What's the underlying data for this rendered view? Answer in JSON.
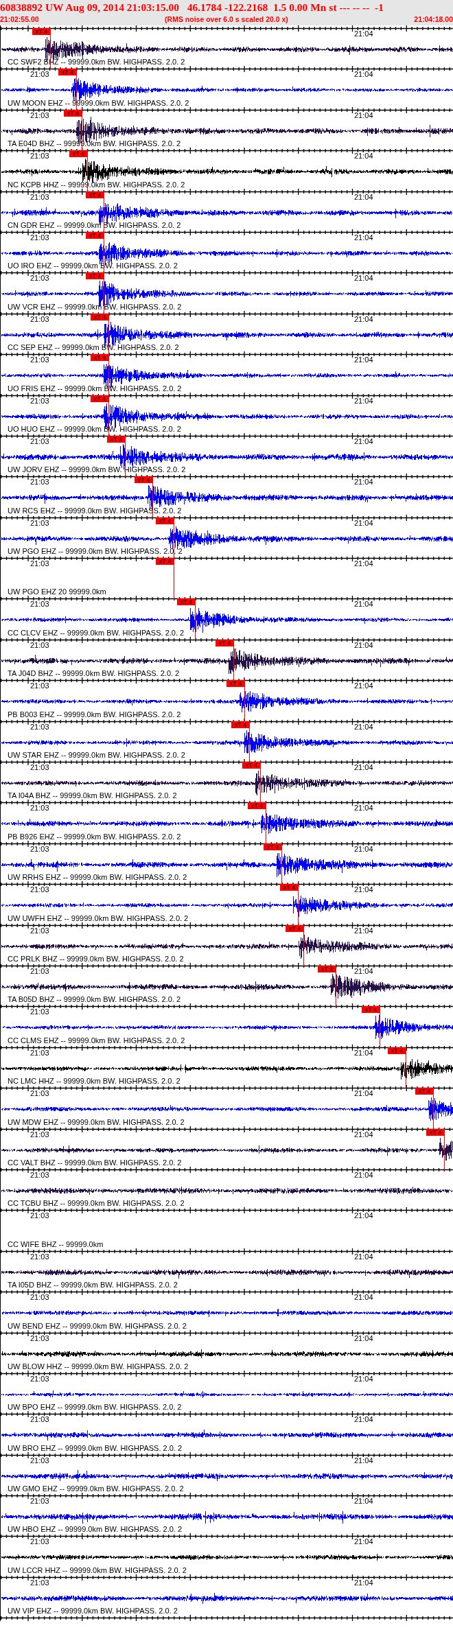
{
  "header": {
    "title": "60838892 UW Aug 09, 2014 21:03:15.00   46.1784 -122.2168  1.5 0.00 Mn st --- -- --  -1",
    "start_time": "21:02:55.00",
    "note": "(RMS noise over 6.0 s scaled 20.0 x)",
    "end_time": "21:04:18.00"
  },
  "traces": [
    {
      "label": "CC SWF2 BHZ -- 99999.0km BW. HIGHPASS. 2.0. 2",
      "kind": "broadband",
      "time_marks": {
        "right": "21:04"
      },
      "pick": {
        "text": "xT 4"
      }
    },
    {
      "label": "UW MOON EHZ -- 99999.0km BW. HIGHPASS. 2.0. 2",
      "kind": "shortperiod",
      "time_marks": {
        "left": "21:03",
        "right": "21:04"
      },
      "pick": {
        "text": "xT 4"
      }
    },
    {
      "label": "TA E04D BHZ -- 99999.0km BW. HIGHPASS. 2.0. 2",
      "kind": "broadband",
      "time_marks": {
        "left": "21:03",
        "right": "21:04"
      },
      "pick": {
        "text": "xT 4"
      }
    },
    {
      "label": "NC KCPB HHZ -- 99999.0km BW. HIGHPASS. 2.0. 2",
      "kind": "highrate",
      "time_marks": {
        "left": "21:03",
        "right": "21:04"
      },
      "pick": {
        "text": "xT 4"
      }
    },
    {
      "label": "CN GDR EHZ -- 99999.0km BW. HIGHPASS. 2.0. 2",
      "kind": "shortperiod",
      "time_marks": {
        "left": "21:03",
        "right": "21:04"
      },
      "pick": {
        "text": "xT 4"
      }
    },
    {
      "label": "UO IRO EHZ -- 99999.0km BW. HIGHPASS. 2.0. 2",
      "kind": "shortperiod",
      "time_marks": {
        "left": "21:03",
        "right": "21:04"
      },
      "pick": {
        "text": "xT 4"
      }
    },
    {
      "label": "UW VCR EHZ -- 99999.0km BW. HIGHPASS. 2.0. 2",
      "kind": "shortperiod",
      "time_marks": {
        "left": "21:03",
        "right": "21:04"
      },
      "pick": {
        "text": "xT 4"
      }
    },
    {
      "label": "CC SEP EHZ -- 99999.0km BW. HIGHPASS. 2.0. 2",
      "kind": "shortperiod",
      "time_marks": {
        "left": "21:03",
        "right": "21:04"
      },
      "pick": {
        "text": "xT 4"
      }
    },
    {
      "label": "UO FRIS EHZ -- 99999.0km BW. HIGHPASS. 2.0. 2",
      "kind": "shortperiod",
      "time_marks": {
        "left": "21:03",
        "right": "21:04"
      },
      "pick": {
        "text": "xT 4"
      }
    },
    {
      "label": "UO HUO EHZ -- 99999.0km BW. HIGHPASS. 2.0. 2",
      "kind": "shortperiod",
      "time_marks": {
        "left": "21:03",
        "right": "21:04"
      },
      "pick": {
        "text": "xT 4"
      }
    },
    {
      "label": "UW JORV EHZ -- 99999.0km BW. HIGHPASS. 2.0. 2",
      "kind": "shortperiod",
      "time_marks": {
        "left": "21:03",
        "right": "21:04"
      },
      "pick": {
        "text": "xT 4"
      }
    },
    {
      "label": "UW RCS EHZ -- 99999.0km BW. HIGHPASS. 2.0. 2",
      "kind": "shortperiod",
      "time_marks": {
        "left": "21:03",
        "right": "21:04"
      },
      "pick": {
        "text": "xT 4"
      }
    },
    {
      "label": "UW PGO EHZ -- 99999.0km BW. HIGHPASS. 2.0. 2",
      "kind": "shortperiod",
      "time_marks": {
        "left": "21:03",
        "right": "21:04"
      },
      "pick": {
        "text": "xT 4"
      }
    },
    {
      "label": "UW PGO EHZ 20 99999.0km",
      "kind": "empty",
      "time_marks": {
        "left": "21:03",
        "right": "21:04"
      },
      "pick": {
        "text": "xT 4"
      }
    },
    {
      "label": "CC CLCV EHZ -- 99999.0km BW. HIGHPASS. 2.0. 2",
      "kind": "shortperiod",
      "time_marks": {
        "left": "21:03",
        "right": "21:04"
      },
      "pick": {
        "text": "xT 4"
      }
    },
    {
      "label": "TA J04D BHZ -- 99999.0km BW. HIGHPASS. 2.0. 2",
      "kind": "broadband",
      "time_marks": {
        "left": "21:03",
        "right": "21:04"
      },
      "pick": {
        "text": "xT 4"
      }
    },
    {
      "label": "PB B003 EHZ -- 99999.0km BW. HIGHPASS. 2.0. 2",
      "kind": "shortperiod",
      "time_marks": {
        "left": "21:03",
        "right": "21:04"
      },
      "pick": {
        "text": "xT 4"
      }
    },
    {
      "label": "UW STAR EHZ -- 99999.0km BW. HIGHPASS. 2.0. 2",
      "kind": "shortperiod",
      "time_marks": {
        "left": "21:03",
        "right": "21:04"
      },
      "pick": {
        "text": "xT 4"
      }
    },
    {
      "label": "TA I04A BHZ -- 99999.0km BW. HIGHPASS. 2.0. 2",
      "kind": "broadband",
      "time_marks": {
        "left": "21:03",
        "right": "21:04"
      },
      "pick": {
        "text": "xT 4"
      }
    },
    {
      "label": "PB B926 EHZ -- 99999.0km BW. HIGHPASS. 2.0. 2",
      "kind": "shortperiod",
      "time_marks": {
        "left": "21:03",
        "right": "21:04"
      },
      "pick": {
        "text": "xT 4"
      }
    },
    {
      "label": "UW RRHS EHZ -- 99999.0km BW. HIGHPASS. 2.0. 2",
      "kind": "shortperiod",
      "time_marks": {
        "left": "21:03",
        "right": "21:04"
      },
      "pick": {
        "text": "xT 4"
      }
    },
    {
      "label": "UW UWFH EHZ -- 99999.0km BW. HIGHPASS. 2.0. 2",
      "kind": "shortperiod",
      "time_marks": {
        "left": "21:03",
        "right": "21:04"
      },
      "pick": {
        "text": "xT 4"
      }
    },
    {
      "label": "CC PRLK BHZ -- 99999.0km BW. HIGHPASS. 2.0. 2",
      "kind": "broadband",
      "time_marks": {
        "left": "21:03",
        "right": "21:04"
      },
      "pick": {
        "text": "xT 4"
      }
    },
    {
      "label": "TA B05D BHZ -- 99999.0km BW. HIGHPASS. 2.0. 2",
      "kind": "broadband",
      "time_marks": {
        "left": "21:03",
        "right": "21:04"
      },
      "pick": {
        "text": "xT 4"
      }
    },
    {
      "label": "CC CLMS EHZ -- 99999.0km BW. HIGHPASS. 2.0. 2",
      "kind": "shortperiod",
      "time_marks": {
        "left": "21:03"
      },
      "pick": {
        "text": "xT 4"
      }
    },
    {
      "label": "NC LMC HHZ -- 99999.0km BW. HIGHPASS. 2.0. 2",
      "kind": "highrate",
      "time_marks": {
        "left": "21:03",
        "right": "21:04"
      },
      "pick": {
        "text": "xT 4"
      }
    },
    {
      "label": "UW MDW EHZ -- 99999.0km BW. HIGHPASS. 2.0. 2",
      "kind": "shortperiod",
      "time_marks": {
        "left": "21:03",
        "right": "21:04"
      },
      "pick": {
        "text": "xT 4"
      }
    },
    {
      "label": "CC VALT BHZ -- 99999.0km BW. HIGHPASS. 2.0. 2",
      "kind": "broadband",
      "time_marks": {
        "left": "21:03",
        "right": "21:04"
      },
      "pick": {
        "text": "xT 4"
      }
    },
    {
      "label": "CC TCBU BHZ -- 99999.0km BW. HIGHPASS. 2.0. 2",
      "kind": "broadband",
      "time_marks": {
        "left": "21:03",
        "right": "21:04"
      }
    },
    {
      "label": "CC WIFE BHZ -- 99999.0km",
      "kind": "empty",
      "time_marks": {
        "left": "21:03",
        "right": "21:04"
      }
    },
    {
      "label": "TA I05D BHZ -- 99999.0km BW. HIGHPASS. 2.0. 2",
      "kind": "broadband",
      "time_marks": {
        "left": "21:03",
        "right": "21:04"
      }
    },
    {
      "label": "UW BEND EHZ -- 99999.0km BW. HIGHPASS. 2.0. 2",
      "kind": "shortperiod",
      "time_marks": {
        "left": "21:03",
        "right": "21:04"
      }
    },
    {
      "label": "UW BLOW HHZ -- 99999.0km BW. HIGHPASS. 2.0. 2",
      "kind": "highrate",
      "time_marks": {
        "left": "21:03",
        "right": "21:04"
      }
    },
    {
      "label": "UW BPO EHZ -- 99999.0km BW. HIGHPASS. 2.0. 2",
      "kind": "shortperiod",
      "time_marks": {
        "left": "21:03",
        "right": "21:04"
      }
    },
    {
      "label": "UW BRO EHZ -- 99999.0km BW. HIGHPASS. 2.0. 2",
      "kind": "shortperiod",
      "time_marks": {
        "left": "21:03",
        "right": "21:04"
      }
    },
    {
      "label": "UW GMO EHZ -- 99999.0km BW. HIGHPASS. 2.0. 2",
      "kind": "shortperiod",
      "time_marks": {
        "left": "21:03",
        "right": "21:04"
      }
    },
    {
      "label": "UW HBO EHZ -- 99999.0km BW. HIGHPASS. 2.0. 2",
      "kind": "shortperiod",
      "time_marks": {
        "left": "21:03",
        "right": "21:04"
      }
    },
    {
      "label": "UW LCCR HHZ -- 99999.0km BW. HIGHPASS. 2.0. 2",
      "kind": "highrate",
      "time_marks": {
        "left": "21:03",
        "right": "21:04"
      }
    },
    {
      "label": "UW VIP EHZ -- 99999.0km BW. HIGHPASS. 2.0. 2",
      "kind": "shortperiod",
      "time_marks": {
        "left": "21:03",
        "right": "21:04"
      }
    }
  ]
}
